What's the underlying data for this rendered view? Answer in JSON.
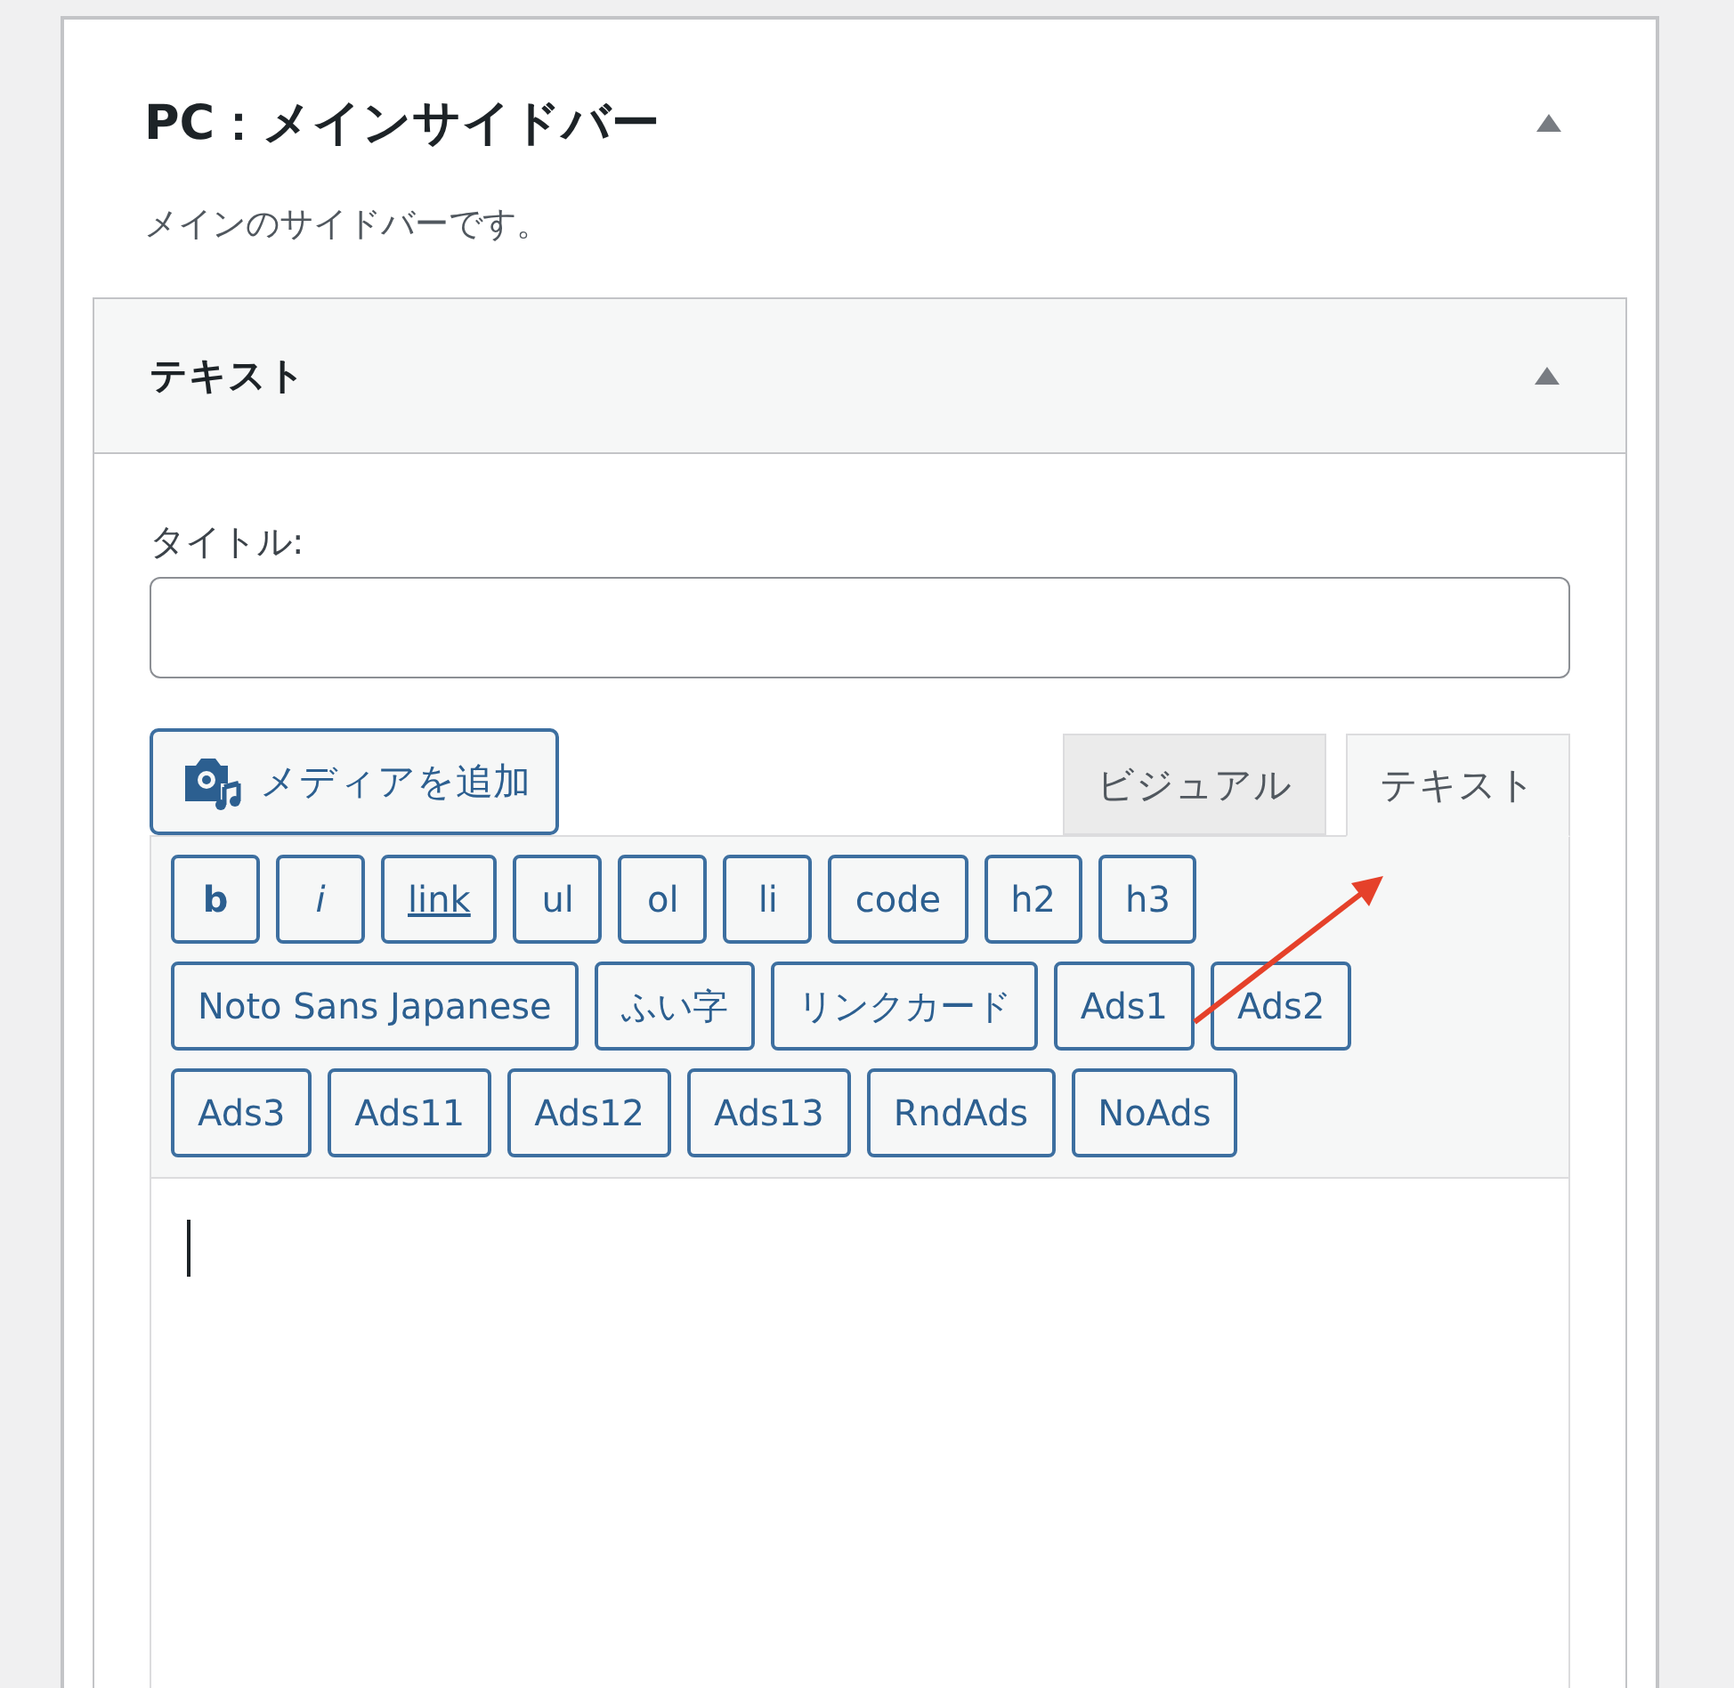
{
  "sidebar": {
    "title": "PC：メインサイドバー",
    "expanded": true,
    "description": "メインのサイドバーです。"
  },
  "widget": {
    "title": "テキスト",
    "expanded": true,
    "title_field": {
      "label": "タイトル:"
    },
    "media_button": "メディアを追加",
    "editor_tabs": [
      {
        "label": "ビジュアル",
        "selected": false
      },
      {
        "label": "テキスト",
        "selected": true
      }
    ],
    "toolbar_buttons": [
      {
        "label": "b",
        "kind": "bold"
      },
      {
        "label": "i",
        "kind": "italic"
      },
      {
        "label": "link",
        "kind": "link"
      },
      {
        "label": "ul",
        "kind": "plain"
      },
      {
        "label": "ol",
        "kind": "plain"
      },
      {
        "label": "li",
        "kind": "plain"
      },
      {
        "label": "code",
        "kind": "plain"
      },
      {
        "label": "h2",
        "kind": "plain"
      },
      {
        "label": "h3",
        "kind": "plain"
      },
      {
        "label": "Noto Sans Japanese",
        "kind": "plain"
      },
      {
        "label": "ふい字",
        "kind": "plain"
      },
      {
        "label": "リンクカード",
        "kind": "plain"
      },
      {
        "label": "Ads1",
        "kind": "plain"
      },
      {
        "label": "Ads2",
        "kind": "plain"
      },
      {
        "label": "Ads3",
        "kind": "plain"
      },
      {
        "label": "Ads11",
        "kind": "plain"
      },
      {
        "label": "Ads12",
        "kind": "plain"
      },
      {
        "label": "Ads13",
        "kind": "plain"
      },
      {
        "label": "RndAds",
        "kind": "plain"
      },
      {
        "label": "NoAds",
        "kind": "plain"
      }
    ]
  }
}
